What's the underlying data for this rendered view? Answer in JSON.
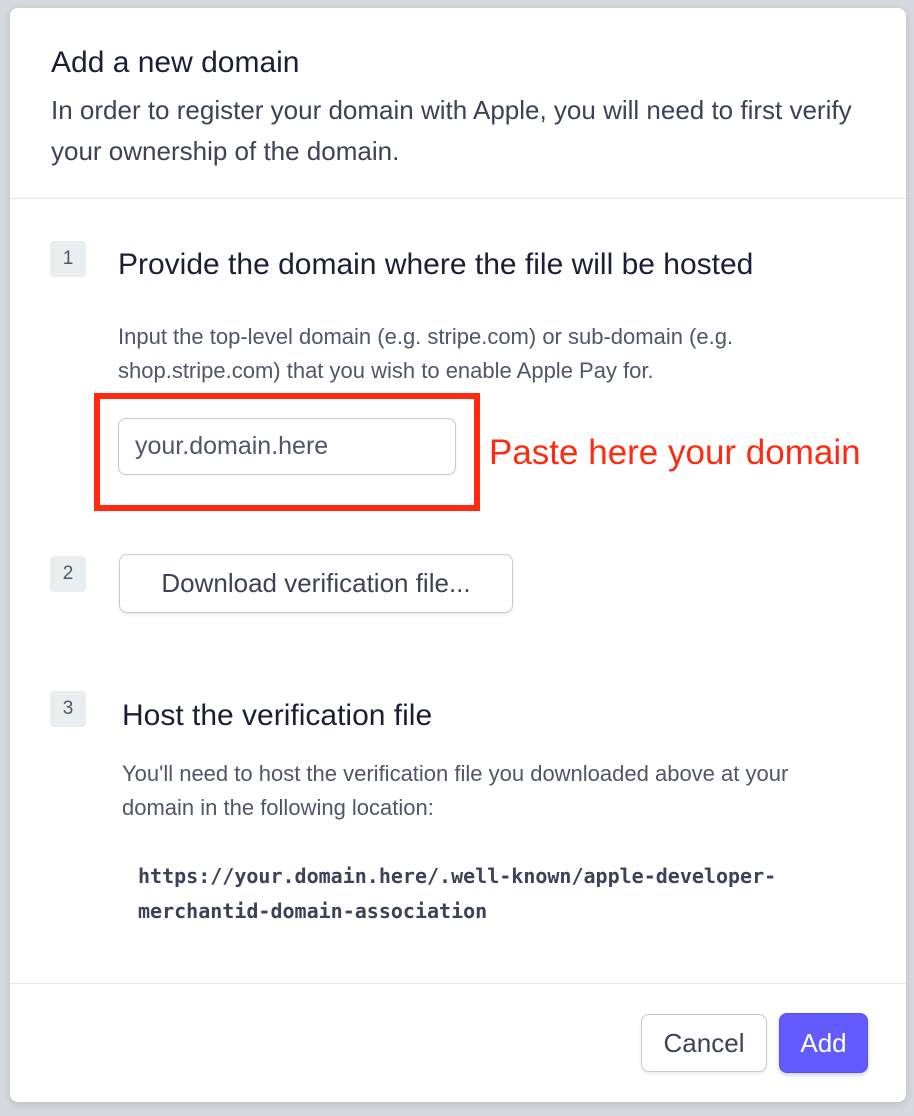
{
  "dialog": {
    "title": "Add a new domain",
    "description": "In order to register your domain with Apple, you will need to first verify your ownership of the domain."
  },
  "steps": [
    {
      "number": "1",
      "title": "Provide the domain where the file will be hosted",
      "description": "Input the top-level domain (e.g. stripe.com) or sub-domain (e.g. shop.stripe.com) that you wish to enable Apple Pay for.",
      "input_placeholder": "your.domain.here",
      "input_value": ""
    },
    {
      "number": "2",
      "button_label": "Download verification file..."
    },
    {
      "number": "3",
      "title": "Host the verification file",
      "description": "You'll need to host the verification file you downloaded above at your domain in the following location:",
      "location_url": "https://your.domain.here/.well-known/apple-developer-merchantid-domain-association"
    }
  ],
  "annotation": {
    "text": "Paste here your domain",
    "color": "#ff2a0f"
  },
  "footer": {
    "cancel_label": "Cancel",
    "add_label": "Add"
  },
  "colors": {
    "primary": "#635bff",
    "highlight": "#ff2a0f"
  }
}
